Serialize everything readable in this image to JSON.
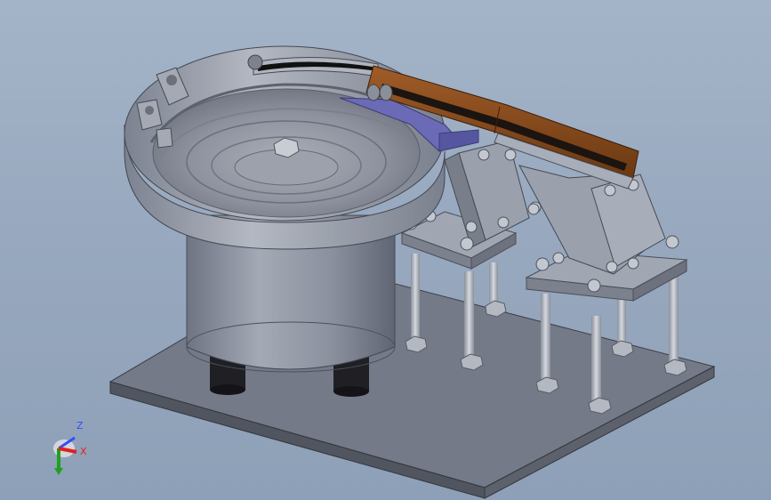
{
  "viewport": {
    "background_top": "#a4b4c8",
    "background_bottom": "#8ea0b7"
  },
  "model": {
    "part_colors": {
      "base_plate": "#6f7584",
      "bowl": "#9aa0ad",
      "drum": "#8f95a3",
      "track_rail": "#8a4a1c",
      "liner": "#6666b0",
      "bracket": "#8d93a0",
      "standoff": "#b4b9c3",
      "feet": "#1d1d22"
    }
  },
  "triad": {
    "z_label": "Z",
    "x_label": "X",
    "z_color": "#3050ff",
    "x_color": "#e02020",
    "y_color": "#20a020"
  }
}
